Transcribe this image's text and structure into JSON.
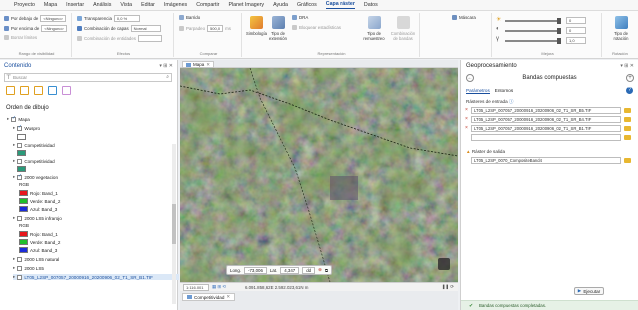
{
  "menu": {
    "items": [
      "Proyecto",
      "Mapa",
      "Insertar",
      "Análisis",
      "Vista",
      "Editar",
      "Imágenes",
      "Compartir",
      "Planet Imagery",
      "Ayuda",
      "Gráficos",
      "Capa ráster",
      "Datos"
    ],
    "active": "Capa ráster"
  },
  "ribbon": {
    "layer_order": {
      "row1_label": "Por debajo de",
      "row1_value": "<Ninguno>",
      "row2_label": "Por encima de",
      "row2_value": "<Ninguno>",
      "row3_label": "Borrar límites",
      "group": "Rango de visibilidad"
    },
    "effects": {
      "transparency_label": "Transparencia",
      "transparency_value": "0,0 %",
      "layer_blend_label": "Combinación de capas",
      "layer_blend_value": "Normal",
      "feature_blend_label": "Combinación de entidades",
      "group": "Efectos"
    },
    "compare": {
      "swipe": "Barrido",
      "flicker_label": "Parpadeo",
      "flicker_value": "500,0",
      "flicker_unit": "ms",
      "group": "Comparar"
    },
    "drawing": {
      "symbology": "Simbología",
      "stretch": "Tipo de extensión",
      "dra": "DRA",
      "stats": "Bloquear estadísticas",
      "resampling": "Tipo de remuestreo",
      "compression": "Combinación de bandas",
      "group": "Representación"
    },
    "mask": {
      "label": "Máscara",
      "group": "Mejora"
    },
    "enhance": {
      "v1": "0",
      "v2": "0",
      "v3": "1,0"
    },
    "rotation": {
      "label": "Tipo de rotación",
      "group": "Rotación"
    }
  },
  "contents": {
    "title": "Contenido",
    "search_placeholder": "Buscar",
    "drawing_order": "Orden de dibujo",
    "items": [
      {
        "label": "Mapa",
        "checked": true
      },
      {
        "label": "Wuspro",
        "checked": true
      },
      {
        "label": "Competitividad",
        "checked": false
      },
      {
        "label": "Competitividad",
        "checked": false
      },
      {
        "label": "2000 vegetacion",
        "checked": true
      },
      {
        "label": "RGB"
      },
      {
        "label": "Rojo: Band_1"
      },
      {
        "label": "Verde: Band_2"
      },
      {
        "label": "Azul: Band_3"
      },
      {
        "label": "2000 LS5 infrarojo",
        "checked": false
      },
      {
        "label": "RGB"
      },
      {
        "label": "Rojo: Band_1"
      },
      {
        "label": "Verde: Band_2"
      },
      {
        "label": "Azul: Band_3"
      },
      {
        "label": "2000 LS5 natural",
        "checked": false
      },
      {
        "label": "2000 LS5",
        "checked": false
      },
      {
        "label": "LT05_L2SP_007057_20000916_20200906_02_T1_SR_B1.TIF",
        "checked": false
      }
    ]
  },
  "map": {
    "tab_label": "Mapa",
    "scale": "1:116.001",
    "coords_status": "6.091.858,62E 2.592.023,61N m",
    "long_label": "Long.",
    "long_value": "-73,006",
    "lat_label": "Lat.",
    "lat_value": "4,347",
    "dms_value": "dd",
    "bottom_tab": "Competitividad"
  },
  "geoprocessing": {
    "title": "Geoprocesamiento",
    "tool_name": "Bandas compuestas",
    "tab_params": "Parámetros",
    "tab_env": "Entornos",
    "input_label": "Rásteres de entrada",
    "inputs": [
      "LT05_L2SP_007057_20000916_20200906_02_T1_SR_B5.TIF",
      "LT05_L2SP_007057_20000916_20200906_02_T1_SR_B4.TIF",
      "LT05_L2SP_007057_20000916_20200906_02_T1_SR_B1.TIF",
      ""
    ],
    "output_label": "Ráster de salida",
    "output_value": "LT05_L2SP_0070_CompositeBand4",
    "run_label": "Ejecutar",
    "status": "Bandas compuestas completadas."
  },
  "colors": {
    "accent": "#1a4f9e",
    "swatch_red": "#e8161d",
    "swatch_green": "#1fbf2b",
    "swatch_blue": "#1b2bd9",
    "swatch_teal": "#2b9a7a"
  }
}
